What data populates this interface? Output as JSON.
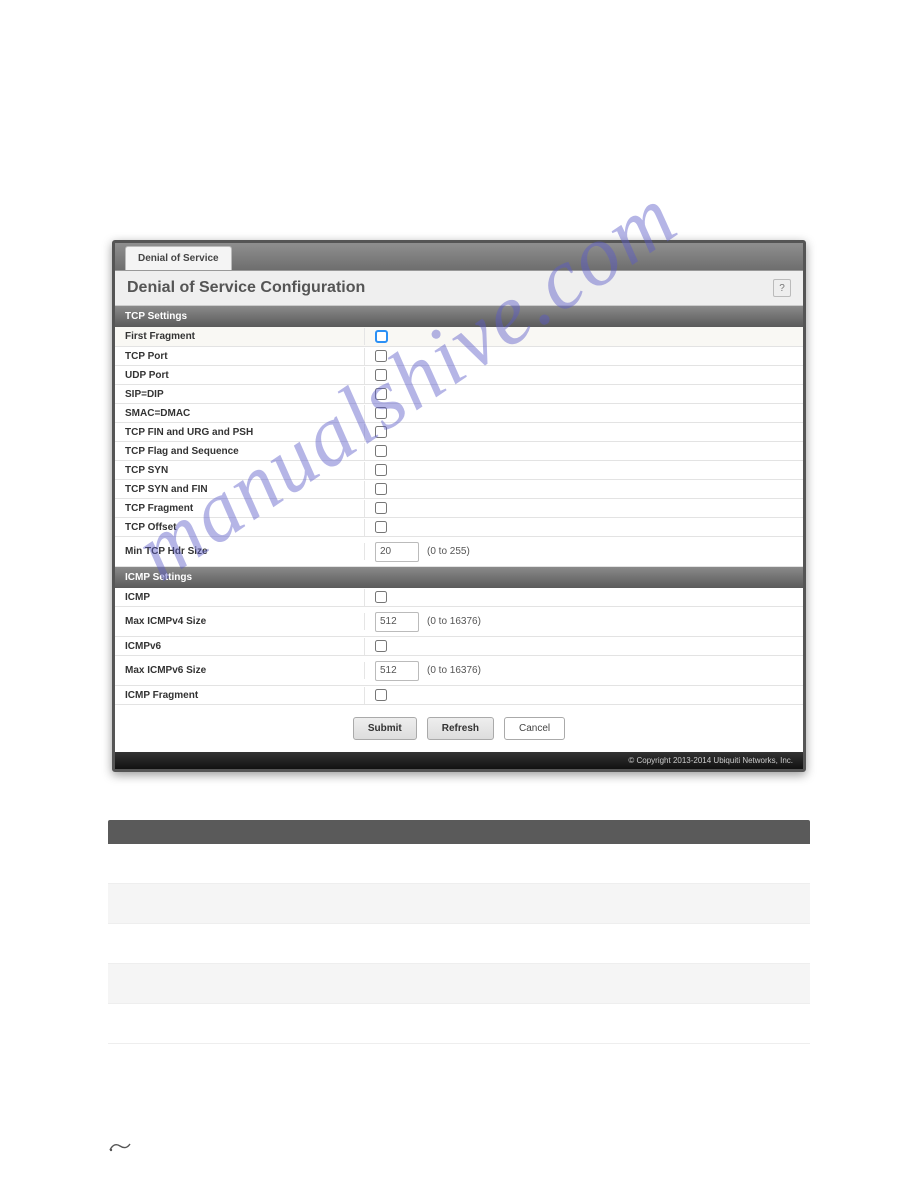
{
  "tab": {
    "label": "Denial of Service"
  },
  "title": "Denial of Service Configuration",
  "help_label": "?",
  "sections": {
    "tcp": {
      "header": "TCP Settings",
      "rows": {
        "first_fragment": "First Fragment",
        "tcp_port": "TCP Port",
        "udp_port": "UDP Port",
        "sip_dip": "SIP=DIP",
        "smac_dmac": "SMAC=DMAC",
        "tcp_fin_urg_psh": "TCP FIN and URG and PSH",
        "tcp_flag_seq": "TCP Flag and Sequence",
        "tcp_syn": "TCP SYN",
        "tcp_syn_fin": "TCP SYN and FIN",
        "tcp_fragment": "TCP Fragment",
        "tcp_offset": "TCP Offset",
        "min_tcp_hdr": "Min TCP Hdr Size",
        "min_tcp_hdr_value": "20",
        "min_tcp_hdr_range": "(0 to 255)"
      }
    },
    "icmp": {
      "header": "ICMP Settings",
      "rows": {
        "icmp": "ICMP",
        "max_icmpv4": "Max ICMPv4 Size",
        "max_icmpv4_value": "512",
        "max_icmpv4_range": "(0 to 16376)",
        "icmpv6": "ICMPv6",
        "max_icmpv6": "Max ICMPv6 Size",
        "max_icmpv6_value": "512",
        "max_icmpv6_range": "(0 to 16376)",
        "icmp_fragment": "ICMP Fragment"
      }
    }
  },
  "buttons": {
    "submit": "Submit",
    "refresh": "Refresh",
    "cancel": "Cancel"
  },
  "footer": "© Copyright 2013-2014 Ubiquiti Networks, Inc.",
  "watermark": "manualshive.com"
}
